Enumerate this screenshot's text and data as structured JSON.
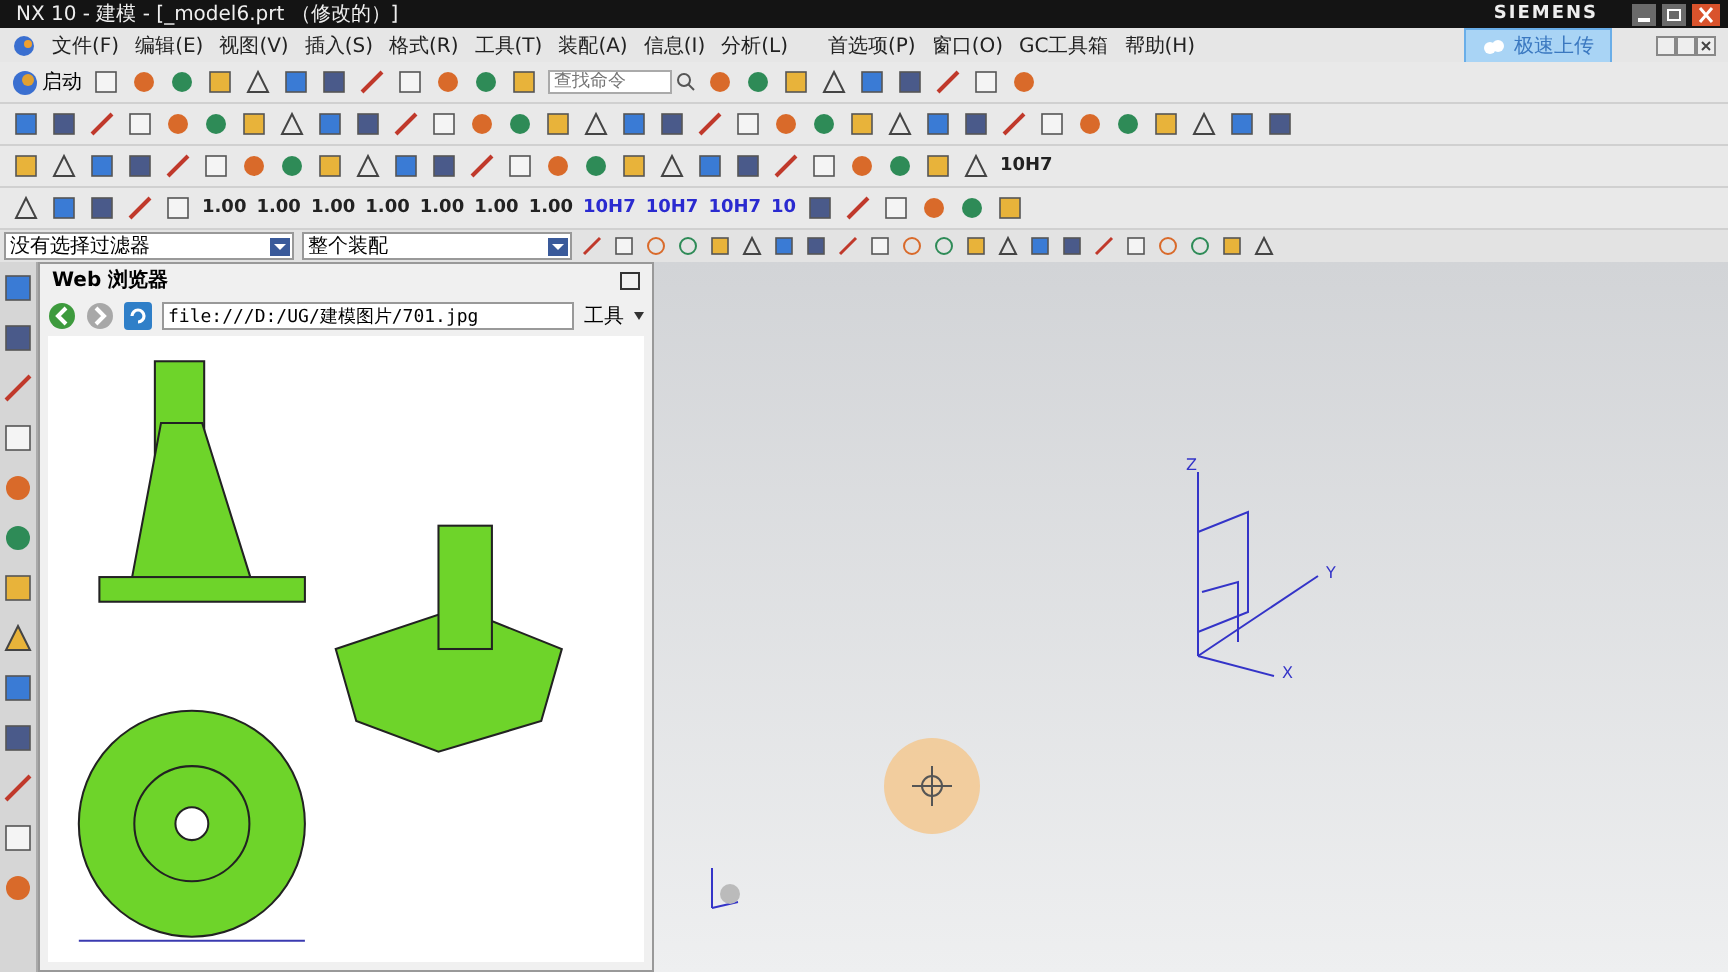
{
  "window": {
    "title": "NX 10 - 建模 - [_model6.prt （修改的）]",
    "brand": "SIEMENS"
  },
  "menu": [
    "文件(F)",
    "编辑(E)",
    "视图(V)",
    "插入(S)",
    "格式(R)",
    "工具(T)",
    "装配(A)",
    "信息(I)",
    "分析(L)",
    "首选项(P)",
    "窗口(O)",
    "GC工具箱",
    "帮助(H)"
  ],
  "cloud_button": "极速上传",
  "toolbar": {
    "start": "启动",
    "search_placeholder": "查找命令",
    "row3_label": "10H7"
  },
  "dimension_labels": [
    "1.00",
    "1.00",
    "1.00",
    "1.00",
    "1.00",
    "1.00",
    "1.00",
    "10H7",
    "10H7",
    "10H7",
    "10"
  ],
  "selection_bar": {
    "filter": "没有选择过滤器",
    "scope": "整个装配"
  },
  "browser": {
    "title": "Web 浏览器",
    "url": "file:///D:/UG/建模图片/701.jpg",
    "tools": "工具"
  },
  "triad": {
    "x": "X",
    "y": "Y",
    "z": "Z"
  }
}
